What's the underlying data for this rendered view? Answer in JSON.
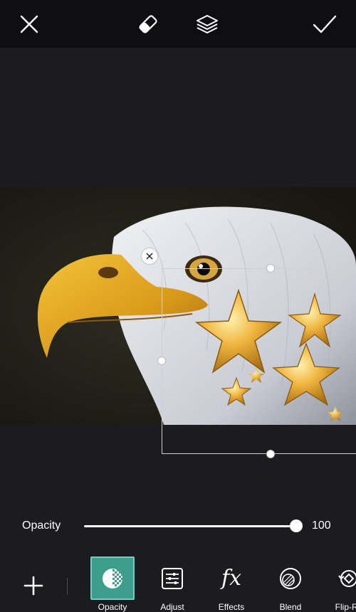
{
  "topbar": {
    "close_icon": "close-icon",
    "eraser_icon": "eraser-icon",
    "layers_icon": "layers-icon",
    "apply_icon": "checkmark-icon"
  },
  "canvas": {
    "photo_subject": "bald eagle",
    "sticker": "gold stars"
  },
  "panel": {
    "opacity_label": "Opacity",
    "opacity_value": "100",
    "opacity_fraction": 1.0
  },
  "toolbar": {
    "add_icon": "plus-icon",
    "tools": [
      {
        "label": "Opacity",
        "icon": "opacity-icon",
        "active": true
      },
      {
        "label": "Adjust",
        "icon": "adjust-icon",
        "active": false
      },
      {
        "label": "Effects",
        "icon": "fx-icon",
        "active": false
      },
      {
        "label": "Blend",
        "icon": "blend-icon",
        "active": false
      },
      {
        "label": "Flip-Ro",
        "icon": "flip-rotate-icon",
        "active": false
      }
    ],
    "fx_glyph": "fx"
  },
  "colors": {
    "accent": "#3d9e8e",
    "background": "#1c1c20",
    "topbar": "#0f0f11"
  }
}
